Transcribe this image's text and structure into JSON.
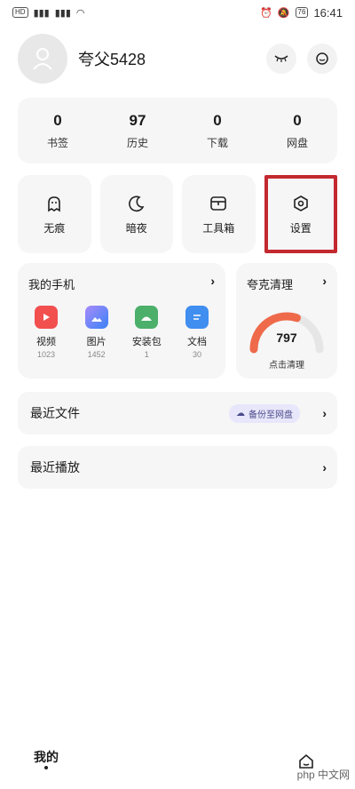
{
  "statusbar": {
    "left_pill": "HD",
    "battery": "76",
    "time": "16:41"
  },
  "profile": {
    "username": "夸父5428",
    "avatar_icon": "user-placeholder-icon"
  },
  "stats": [
    {
      "value": "0",
      "label": "书签"
    },
    {
      "value": "97",
      "label": "历史"
    },
    {
      "value": "0",
      "label": "下载"
    },
    {
      "value": "0",
      "label": "网盘"
    }
  ],
  "tools": [
    {
      "label": "无痕",
      "icon": "ghost-icon"
    },
    {
      "label": "暗夜",
      "icon": "moon-icon"
    },
    {
      "label": "工具箱",
      "icon": "toolbox-icon"
    },
    {
      "label": "设置",
      "icon": "hexagon-settings-icon"
    }
  ],
  "phone": {
    "title": "我的手机",
    "apps": [
      {
        "label": "视频",
        "count": "1023",
        "color": "#f24f4f"
      },
      {
        "label": "图片",
        "count": "1452",
        "color": "#6a7cf2"
      },
      {
        "label": "安装包",
        "count": "1",
        "color": "#4caf6a"
      },
      {
        "label": "文档",
        "count": "30",
        "color": "#3f8ef0"
      }
    ]
  },
  "clean": {
    "title": "夸克清理",
    "value": "797",
    "label": "点击清理",
    "gauge_fraction": 0.6
  },
  "recent_files": {
    "label": "最近文件",
    "backup": "备份至网盘"
  },
  "recent_play": {
    "label": "最近播放"
  },
  "bottom": {
    "mine": "我的"
  },
  "watermark": "php 中文网"
}
